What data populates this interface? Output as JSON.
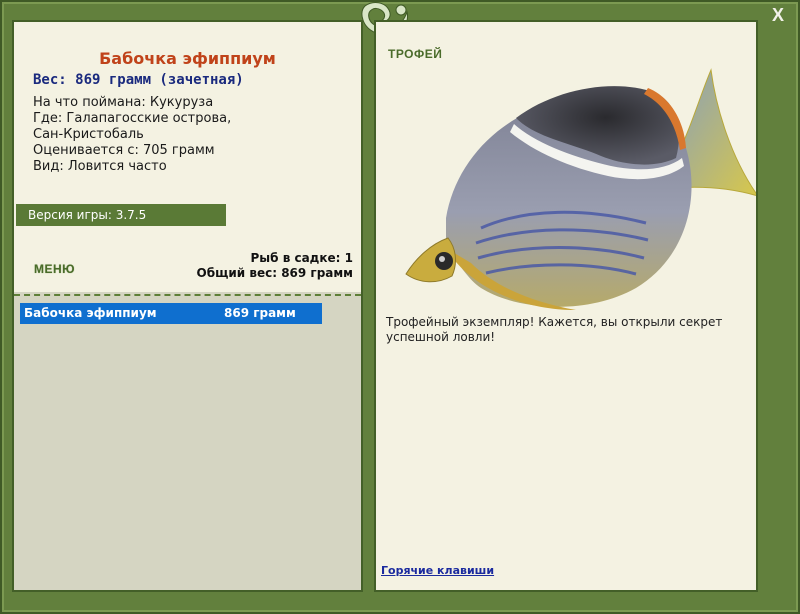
{
  "fish": {
    "title": "Бабочка эфиппиум",
    "weight": "Вес: 869 грамм (зачетная)",
    "details": [
      "На что поймана: Кукуруза",
      "Где: Галапагосские острова,\nСан-Кристобаль",
      "Оценивается с: 705 грамм",
      "Вид: Ловится часто"
    ]
  },
  "version": "Версия игры: 3.7.5",
  "menu_label": "МЕНЮ",
  "keepnet": {
    "count_label": "Рыб в садке: 1",
    "total_label": "Общий вес: 869 грамм"
  },
  "list": [
    {
      "name": "Бабочка эфиппиум",
      "weight": "869 грамм",
      "selected": true
    }
  ],
  "trophy": {
    "label": "ТРОФЕЙ",
    "text": "Трофейный экземпляр! Кажется, вы открыли секрет успешной ловли!"
  },
  "hotkeys_label": "Горячие клавиши",
  "close_label": "X",
  "colors": {
    "frame": "#62803d",
    "panel": "#f4f2e2",
    "title": "#c0431a",
    "weight": "#1a2a7e",
    "selection": "#0f6fcf"
  }
}
